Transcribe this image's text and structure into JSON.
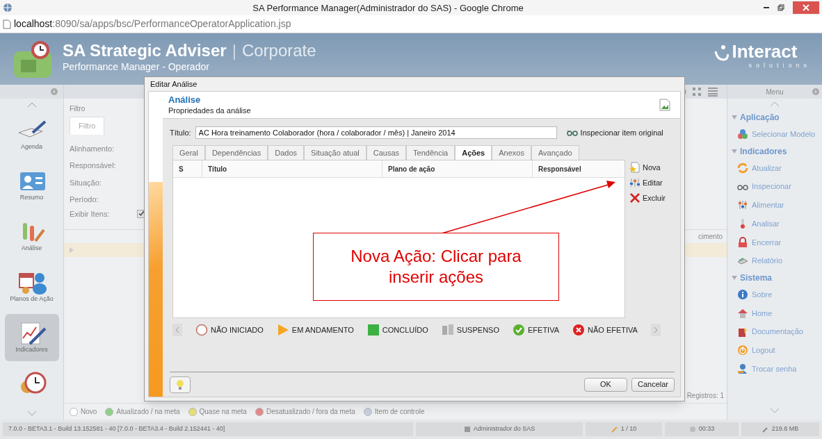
{
  "browser": {
    "title": "SA Performance Manager(Administrador do SAS) - Google Chrome",
    "url_host": "localhost",
    "url_path": ":8090/sa/apps/bsc/PerformanceOperatorApplication.jsp"
  },
  "app_header": {
    "title": "SA Strategic Adviser",
    "separator": "|",
    "edition": "Corporate",
    "subtitle": "Performance Manager - Operador",
    "logo": "Interact",
    "logo_tagline": "solutions"
  },
  "left_nav": [
    {
      "label": "Agenda",
      "selected": false
    },
    {
      "label": "Resumo",
      "selected": false
    },
    {
      "label": "Análise",
      "selected": false
    },
    {
      "label": "Planos de Ação",
      "selected": false
    },
    {
      "label": "Indicadores",
      "selected": true
    }
  ],
  "filter_panel": {
    "header": "Filtro",
    "tab": "Filtro",
    "labels": [
      "Alinhamento:",
      "Responsável:",
      "Situação:",
      "Período:"
    ],
    "show_items": {
      "label": "Exibir Itens:",
      "checked": true
    }
  },
  "grid": {
    "column_fragment": "cimento",
    "records": "Registros: 1"
  },
  "legend": [
    {
      "label": "Novo",
      "color": "#ffffff"
    },
    {
      "label": "Atualizado / na meta",
      "color": "#8fd08a"
    },
    {
      "label": "Quase na meta",
      "color": "#e8e27a"
    },
    {
      "label": "Desatualizado / fora da meta",
      "color": "#e88a8a"
    },
    {
      "label": "Item de controle",
      "color": "#c8d0e0"
    }
  ],
  "status_bar": {
    "version": "7.0.0 - BETA3.1 - Build 13.152581 - 40 [7.0.0 - BETA3.4 - Build 2.152441 - 40]",
    "user": "Administrador do SAS",
    "pages": "1 / 10",
    "time": "00:33",
    "memory": "219.8 MB"
  },
  "right_menu": {
    "title": "Menu",
    "sections": [
      {
        "label": "Aplicação",
        "expanded": true,
        "items": [
          "Selecionar Modelo"
        ]
      },
      {
        "label": "Indicadores",
        "expanded": true,
        "items": [
          "Atualizar",
          "Inspecionar",
          "Alimentar",
          "Analisar",
          "Encerrar",
          "Relatório"
        ]
      },
      {
        "label": "Sistema",
        "expanded": true,
        "items": [
          "Sobre",
          "Home",
          "Documentação",
          "Logout",
          "Trocar senha"
        ]
      }
    ]
  },
  "dialog": {
    "title": "Editar Análise",
    "heading": "Análise",
    "subheading": "Propriedades da análise",
    "title_label": "Título:",
    "title_value": "AC Hora treinamento Colaborador (hora / colaborador / mês) | Janeiro 2014",
    "inspect": "Inspecionar item original",
    "tabs": [
      {
        "label": "Geral",
        "selected": false
      },
      {
        "label": "Dependências",
        "selected": false
      },
      {
        "label": "Dados",
        "selected": false
      },
      {
        "label": "Situação atual",
        "selected": false
      },
      {
        "label": "Causas",
        "selected": false
      },
      {
        "label": "Tendência",
        "selected": false
      },
      {
        "label": "Ações",
        "selected": true
      },
      {
        "label": "Anexos",
        "selected": false
      },
      {
        "label": "Avançado",
        "selected": false
      }
    ],
    "table": {
      "columns": [
        "S",
        "Título",
        "Plano de ação",
        "Responsável"
      ]
    },
    "actions": [
      {
        "label": "Nova",
        "kind": "new"
      },
      {
        "label": "Editar",
        "kind": "edit"
      },
      {
        "label": "Excluir",
        "kind": "delete"
      }
    ],
    "status_legend": [
      {
        "label": "NÃO INICIADO",
        "kind": "not_started"
      },
      {
        "label": "EM ANDAMENTO",
        "kind": "in_progress"
      },
      {
        "label": "CONCLUÍDO",
        "kind": "done"
      },
      {
        "label": "SUSPENSO",
        "kind": "suspended"
      },
      {
        "label": "EFETIVA",
        "kind": "effective"
      },
      {
        "label": "NÃO EFETIVA",
        "kind": "not_effective"
      }
    ],
    "buttons": [
      "OK",
      "Cancelar"
    ]
  },
  "annotation": {
    "text": "Nova Ação: Clicar para inserir ações"
  }
}
